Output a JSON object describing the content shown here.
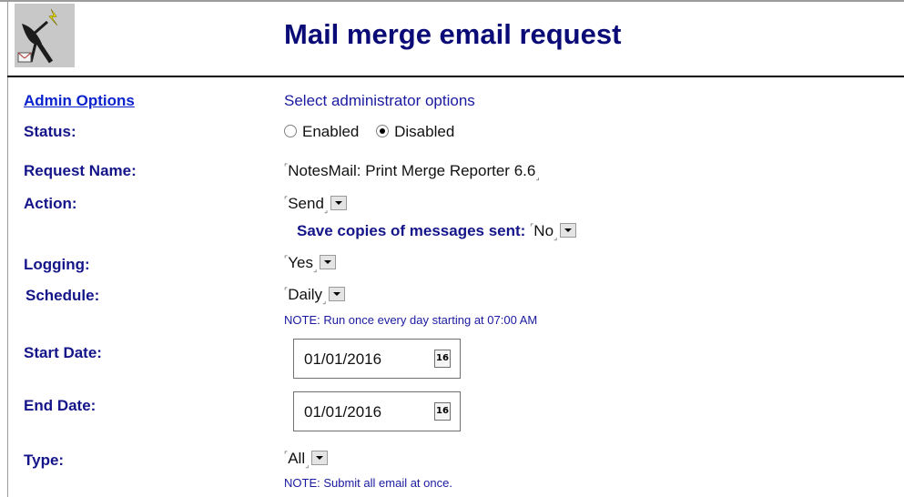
{
  "header": {
    "title": "Mail merge email request",
    "logo_icon": "satellite-dish-icon"
  },
  "admin": {
    "link_label": "Admin Options",
    "description": "Select administrator options"
  },
  "status": {
    "label": "Status:",
    "options": [
      "Enabled",
      "Disabled"
    ],
    "selected": "Disabled"
  },
  "request_name": {
    "label": "Request Name:",
    "value": "NotesMail: Print Merge Reporter 6.6"
  },
  "action": {
    "label": "Action:",
    "value": "Send"
  },
  "save_copies": {
    "label": "Save copies of messages sent:",
    "value": "No"
  },
  "logging": {
    "label": "Logging:",
    "value": "Yes"
  },
  "schedule": {
    "label": "Schedule:",
    "value": "Daily",
    "note": "NOTE: Run once every day starting at 07:00 AM"
  },
  "start_date": {
    "label": "Start Date:",
    "value": "01/01/2016",
    "calendar": "16"
  },
  "end_date": {
    "label": "End Date:",
    "value": "01/01/2016",
    "calendar": "16"
  },
  "type": {
    "label": "Type:",
    "value": "All",
    "note": "NOTE: Submit all email at once."
  }
}
